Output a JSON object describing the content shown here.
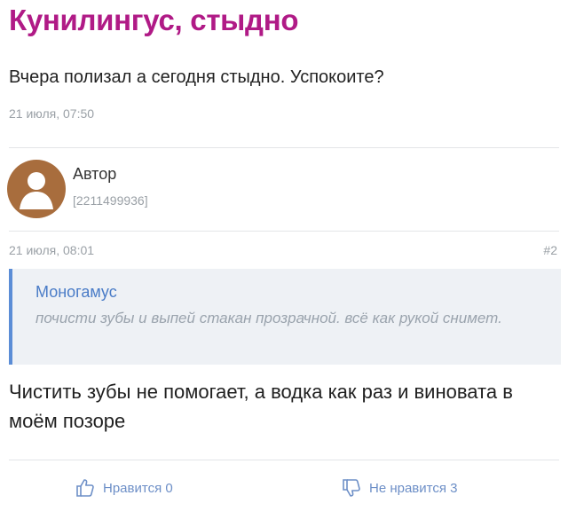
{
  "topic": {
    "title": "Кунилингус, стыдно",
    "question": "Вчера полизал а сегодня стыдно. Успокоите?",
    "time": "21 июля, 07:50"
  },
  "reply": {
    "author": "Автор",
    "author_id": "[2211499936]",
    "time": "21 июля, 08:01",
    "number": "#2",
    "quote": {
      "author": "Моногамус",
      "text": "почисти зубы и выпей стакан прозрачной. всё как рукой снимет."
    },
    "text": "Чистить зубы не помогает, а водка как раз и виновата в моём позоре"
  },
  "actions": {
    "like_label": "Нравится 0",
    "dislike_label": "Не нравится 3"
  },
  "colors": {
    "title": "#b01a86",
    "accent": "#4a7cc7",
    "quote_bar": "#5b8dd6",
    "avatar": "#a86d3d"
  },
  "icons": {
    "avatar": "user-silhouette-icon",
    "like": "thumbs-up-icon",
    "dislike": "thumbs-down-icon"
  }
}
